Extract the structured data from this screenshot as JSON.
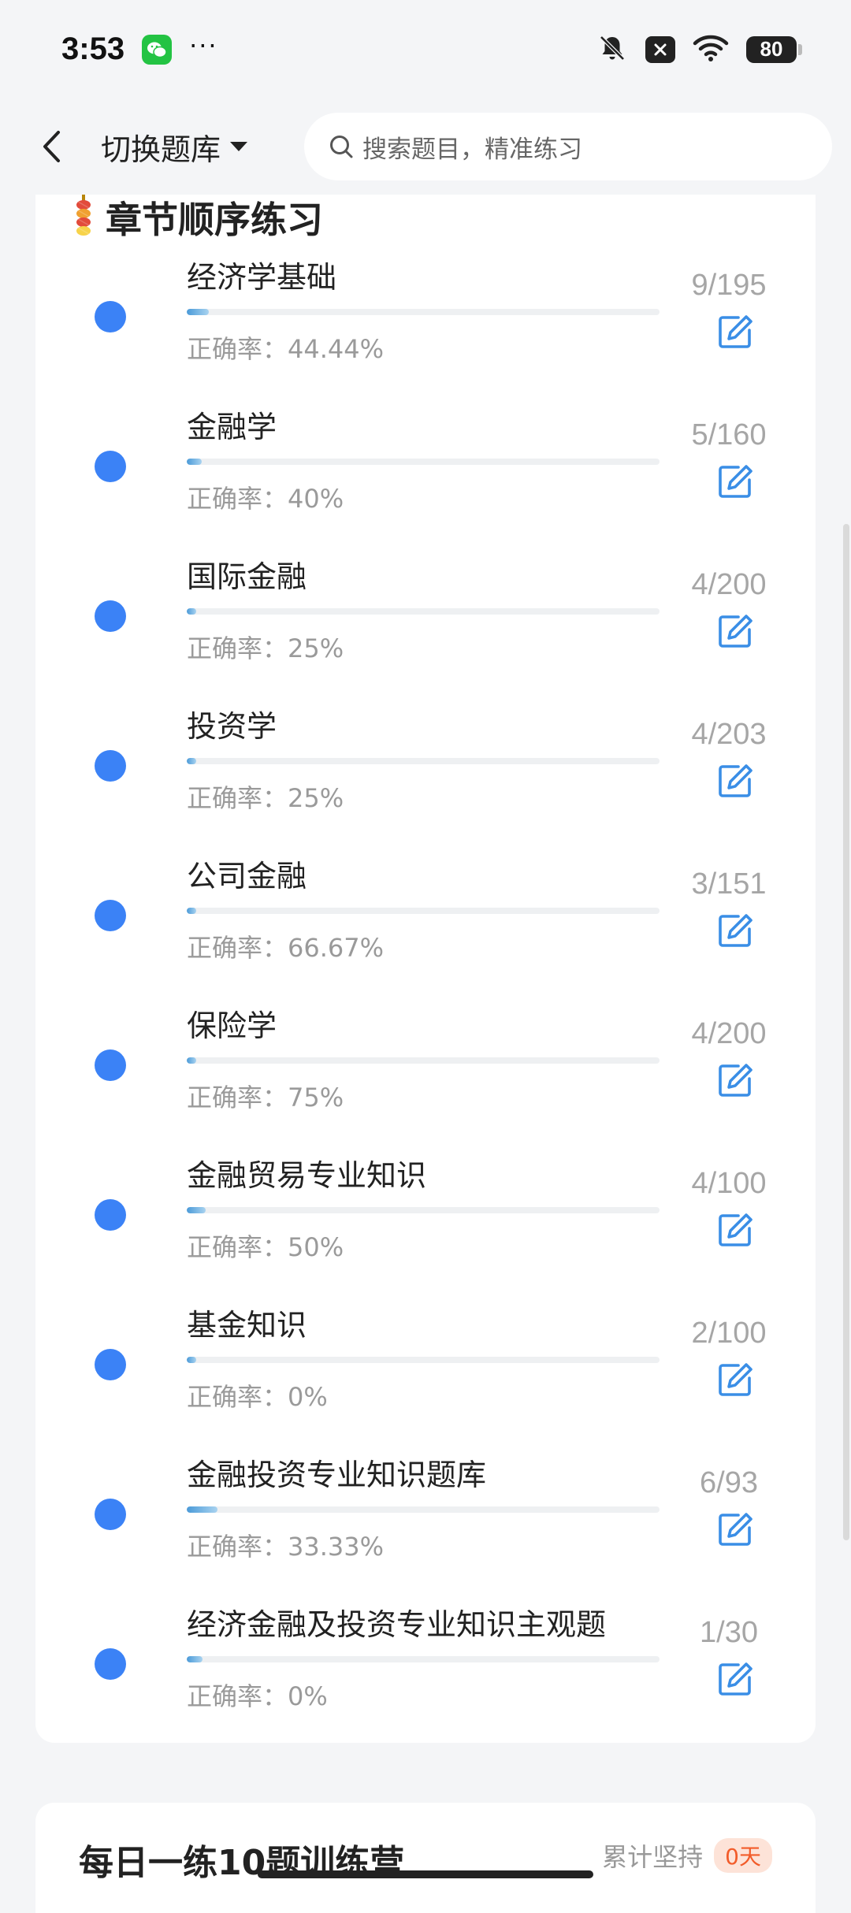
{
  "status_bar": {
    "time": "3:53",
    "dots": "···",
    "battery": "80"
  },
  "nav": {
    "switch_label": "切换题库",
    "search_placeholder": "搜索题目，精准练习"
  },
  "section": {
    "title": "章节顺序练习"
  },
  "items": [
    {
      "name": "经济学基础",
      "accuracy": "正确率：44.44%",
      "count": "9/195",
      "progress": 0.046
    },
    {
      "name": "金融学",
      "accuracy": "正确率：40%",
      "count": "5/160",
      "progress": 0.031
    },
    {
      "name": "国际金融",
      "accuracy": "正确率：25%",
      "count": "4/200",
      "progress": 0.02
    },
    {
      "name": "投资学",
      "accuracy": "正确率：25%",
      "count": "4/203",
      "progress": 0.02
    },
    {
      "name": "公司金融",
      "accuracy": "正确率：66.67%",
      "count": "3/151",
      "progress": 0.02
    },
    {
      "name": "保险学",
      "accuracy": "正确率：75%",
      "count": "4/200",
      "progress": 0.02
    },
    {
      "name": "金融贸易专业知识",
      "accuracy": "正确率：50%",
      "count": "4/100",
      "progress": 0.04
    },
    {
      "name": "基金知识",
      "accuracy": "正确率：0%",
      "count": "2/100",
      "progress": 0.02
    },
    {
      "name": "金融投资专业知识题库",
      "accuracy": "正确率：33.33%",
      "count": "6/93",
      "progress": 0.065
    },
    {
      "name": "经济金融及投资专业知识主观题",
      "accuracy": "正确率：0%",
      "count": "1/30",
      "progress": 0.033
    }
  ],
  "next_card": {
    "title": "每日一练10题训练营",
    "cumulative_label": "累计坚持",
    "badge": "0天"
  },
  "colors": {
    "accent": "#3b82f6",
    "edit_icon": "#3a8ee6",
    "background": "#f4f5f7"
  }
}
